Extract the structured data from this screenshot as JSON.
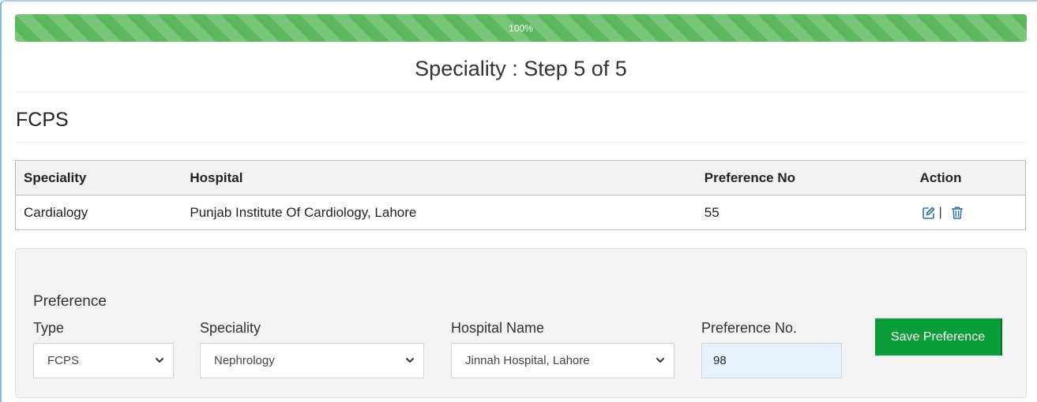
{
  "progress": {
    "label": "100%",
    "value": 100
  },
  "header": {
    "title": "Speciality : Step 5 of 5"
  },
  "section": {
    "title": "FCPS"
  },
  "table": {
    "headers": [
      "Speciality",
      "Hospital",
      "Preference No",
      "Action"
    ],
    "rows": [
      {
        "speciality": "Cardialogy",
        "hospital": "Punjab Institute Of Cardiology, Lahore",
        "preference_no": "55",
        "separator": "|"
      }
    ]
  },
  "form": {
    "legend": "Preference",
    "type_label": "Type",
    "type_value": "FCPS",
    "speciality_label": "Speciality",
    "speciality_value": "Nephrology",
    "hospital_label": "Hospital Name",
    "hospital_value": "Jinnah Hospital, Lahore",
    "preference_label": "Preference No.",
    "preference_value": "98",
    "save_label": "Save Preference"
  },
  "icons": {
    "edit": "edit-icon",
    "delete": "trash-icon",
    "dropdown": "chevron-down-icon"
  },
  "colors": {
    "progress": "#5cb85c",
    "save_button": "#0a9d38",
    "icon_blue": "#2f6fb5",
    "input_autofill": "#e8f0fe"
  }
}
